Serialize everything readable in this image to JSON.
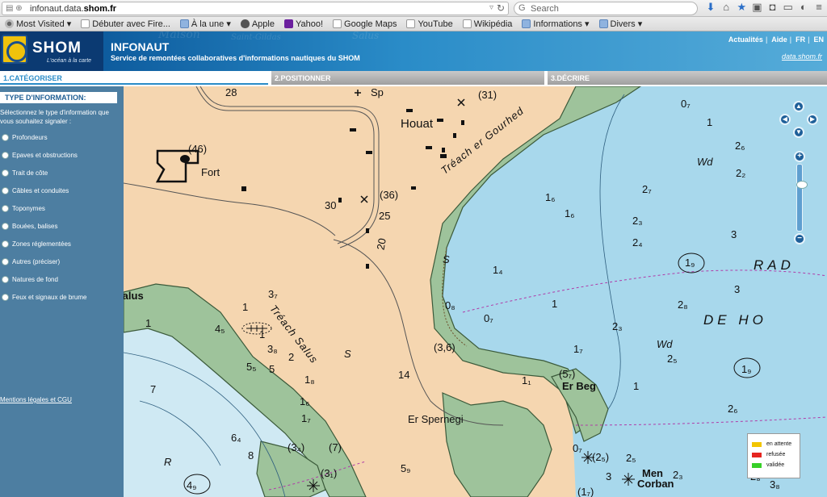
{
  "browser": {
    "url_prefix": "infonaut.data.",
    "url_domain": "shom.fr",
    "search_placeholder": "Search",
    "bookmarks": [
      {
        "label": "Most Visited",
        "icon": "gear-icon",
        "has_menu": true
      },
      {
        "label": "Débuter avec Fire...",
        "icon": "doc-icon",
        "has_menu": false
      },
      {
        "label": "À la une",
        "icon": "rss-icon",
        "has_menu": true
      },
      {
        "label": "Apple",
        "icon": "apple-icon",
        "has_menu": false
      },
      {
        "label": "Yahoo!",
        "icon": "yahoo-icon",
        "has_menu": false
      },
      {
        "label": "Google Maps",
        "icon": "doc-icon",
        "has_menu": false
      },
      {
        "label": "YouTube",
        "icon": "doc-icon",
        "has_menu": false
      },
      {
        "label": "Wikipédia",
        "icon": "doc-icon",
        "has_menu": false
      },
      {
        "label": "Informations",
        "icon": "folder-icon",
        "has_menu": true
      },
      {
        "label": "Divers",
        "icon": "folder-icon",
        "has_menu": true
      }
    ]
  },
  "header": {
    "logo_text": "SHOM",
    "logo_tagline": "L'océan à la carte",
    "title": "INFONAUT",
    "subtitle": "Service de remontées collaboratives d'informations nautiques du SHOM",
    "links": [
      "Actualités",
      "Aide",
      "FR",
      "EN"
    ],
    "data_link": "data.shom.fr",
    "bg_words": [
      "Maison",
      "Saint-Gildas",
      "Salus"
    ]
  },
  "tabs": [
    {
      "label": "1.CATÉGORISER",
      "active": true
    },
    {
      "label": "2.POSITIONNER",
      "active": false
    },
    {
      "label": "3.DÉCRIRE",
      "active": false
    }
  ],
  "sidebar": {
    "header": "TYPE D'INFORMATION:",
    "intro": "Sélectionnez le type d'information que vous souhaitez signaler :",
    "options": [
      "Profondeurs",
      "Epaves et obstructions",
      "Trait de côte",
      "Câbles et conduites",
      "Toponymes",
      "Bouées, balises",
      "Zones réglementées",
      "Autres (préciser)",
      "Natures de fond",
      "Feux et signaux de brume"
    ],
    "legal_link": "Mentions légales et CGU"
  },
  "map": {
    "labels": [
      {
        "text": "Houat",
        "cls": "big"
      },
      {
        "text": "Fort",
        "cls": ""
      },
      {
        "text": "Er Spernegi",
        "cls": ""
      },
      {
        "text": "Er Beg",
        "cls": "bold"
      },
      {
        "text": "Men",
        "cls": "bold"
      },
      {
        "text": "Corban",
        "cls": "bold"
      },
      {
        "text": "Salus",
        "cls": "bold"
      },
      {
        "text": "Sp",
        "cls": ""
      },
      {
        "text": "RAD",
        "cls": "wide"
      },
      {
        "text": "DE HO",
        "cls": "wide"
      },
      {
        "text": "Tréach er Gourhed",
        "cls": "ital"
      },
      {
        "text": "Tréach Salus",
        "cls": "ital"
      },
      {
        "text": "Wd",
        "cls": ""
      },
      {
        "text": "Wd",
        "cls": ""
      },
      {
        "text": "S",
        "cls": ""
      },
      {
        "text": "S",
        "cls": ""
      },
      {
        "text": "R",
        "cls": ""
      }
    ],
    "soundings": [
      "28",
      "(46)",
      "(31)",
      "(36)",
      "25",
      "30",
      "20",
      "0₇",
      "1",
      "2₆",
      "2₂",
      "2₇",
      "1₆",
      "1₆",
      "2₃",
      "2₄",
      "3",
      "1₉",
      "1₄",
      "0₈",
      "0₇",
      "1",
      "2₈",
      "3",
      "2₃",
      "1₇",
      "2₅",
      "1₉",
      "1",
      "2₆",
      "3₇",
      "1",
      "4₅",
      "1",
      "3₈",
      "2",
      "5₅",
      "5",
      "7",
      "1₈",
      "14",
      "(3,6)",
      "(5₇)",
      "1₆",
      "1₇",
      "6₄",
      "8",
      "(3₄)",
      "(7)",
      "(3₁)",
      "4₉",
      "(2₅)",
      "0₇",
      "2₅",
      "2₃",
      "3",
      "2₈",
      "3₈",
      "5₉",
      "(1₇)",
      "1₁",
      "1"
    ],
    "zoom_plus": "+",
    "zoom_minus": "−",
    "legend": [
      {
        "label": "en attente",
        "color": "#f2c500"
      },
      {
        "label": "refusée",
        "color": "#e52520"
      },
      {
        "label": "validée",
        "color": "#37d028"
      }
    ]
  }
}
